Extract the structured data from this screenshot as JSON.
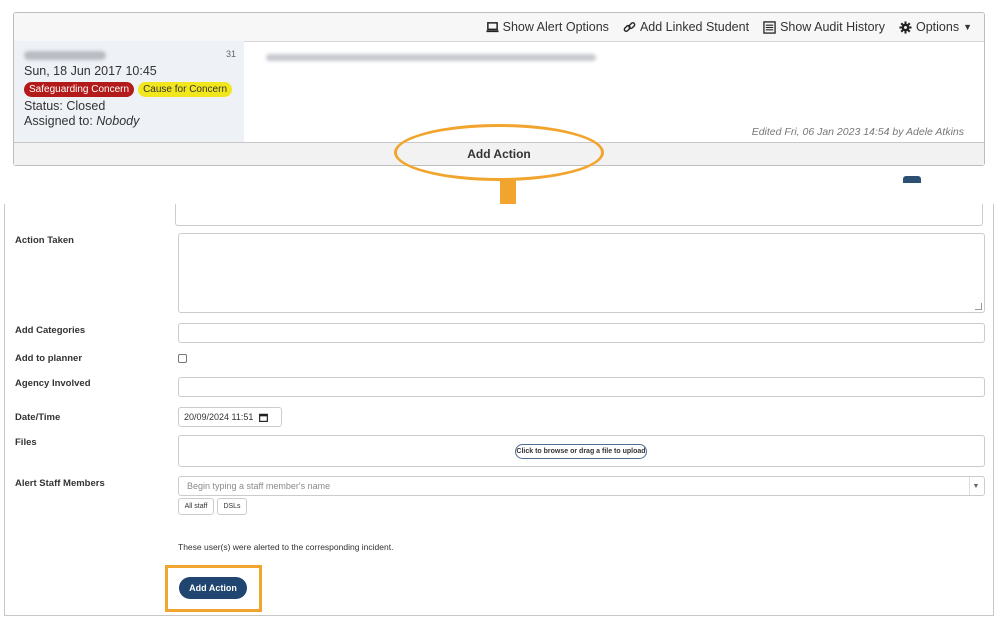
{
  "toolbar": {
    "show_alert_options": "Show Alert Options",
    "add_linked_student": "Add Linked Student",
    "show_audit_history": "Show Audit History",
    "options": "Options"
  },
  "incident": {
    "count": "31",
    "datetime": "Sun, 18 Jun 2017 10:45",
    "badges": [
      "Safeguarding Concern",
      "Cause for Concern"
    ],
    "status": "Status: Closed",
    "assigned_label": "Assigned to: ",
    "assigned_value": "Nobody",
    "edited": "Edited Fri, 06 Jan 2023 14:54 by Adele Atkins"
  },
  "add_action_bar": "Add Action",
  "form": {
    "action_taken_label": "Action Taken",
    "add_categories_label": "Add Categories",
    "add_to_planner_label": "Add to planner",
    "agency_involved_label": "Agency Involved",
    "datetime_label": "Date/Time",
    "datetime_value": "20/09/2024 11:51",
    "files_label": "Files",
    "upload_button": "Click to browse or drag a file to upload",
    "alert_staff_label": "Alert Staff Members",
    "staff_placeholder": "Begin typing a staff member's name",
    "all_staff": "All staff",
    "dsls": "DSLs",
    "note": "These user(s) were alerted to the corresponding incident.",
    "submit": "Add Action"
  },
  "colors": {
    "highlight": "#f2a52e",
    "primary": "#1f4570",
    "badge_red": "#b31b1b",
    "badge_yellow": "#f2e61c"
  }
}
